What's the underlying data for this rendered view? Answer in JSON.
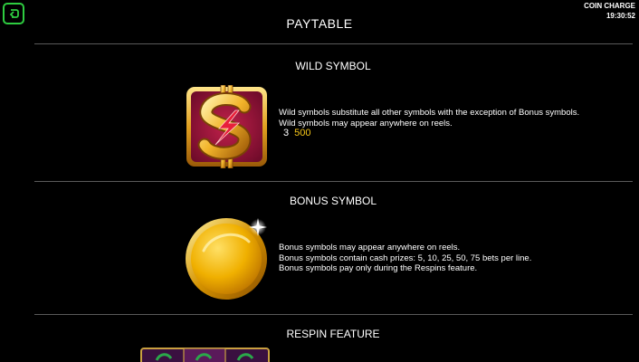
{
  "header": {
    "title": "PAYTABLE",
    "coin_charge_label": "COIN CHARGE",
    "clock": "19:30:52"
  },
  "sections": {
    "wild": {
      "title": "WILD SYMBOL",
      "lines": [
        "Wild symbols substitute all other symbols with the exception of Bonus symbols.",
        "Wild symbols may appear anywhere on reels."
      ],
      "payout_count": "3",
      "payout_value": "500"
    },
    "bonus": {
      "title": "BONUS SYMBOL",
      "lines": [
        "Bonus symbols may appear anywhere on reels.",
        "Bonus symbols contain cash prizes: 5, 10, 25, 50, 75 bets per line.",
        "Bonus symbols pay only during the Respins feature."
      ]
    },
    "respin": {
      "title": "RESPIN FEATURE"
    }
  },
  "colors": {
    "accent_green": "#2ecc40",
    "payout_gold": "#f5c518",
    "divider": "#5a5a5a"
  },
  "icons": {
    "back": "return-arrow-icon",
    "wild": "dollar-lightning-icon",
    "bonus": "gold-coin-icon"
  }
}
